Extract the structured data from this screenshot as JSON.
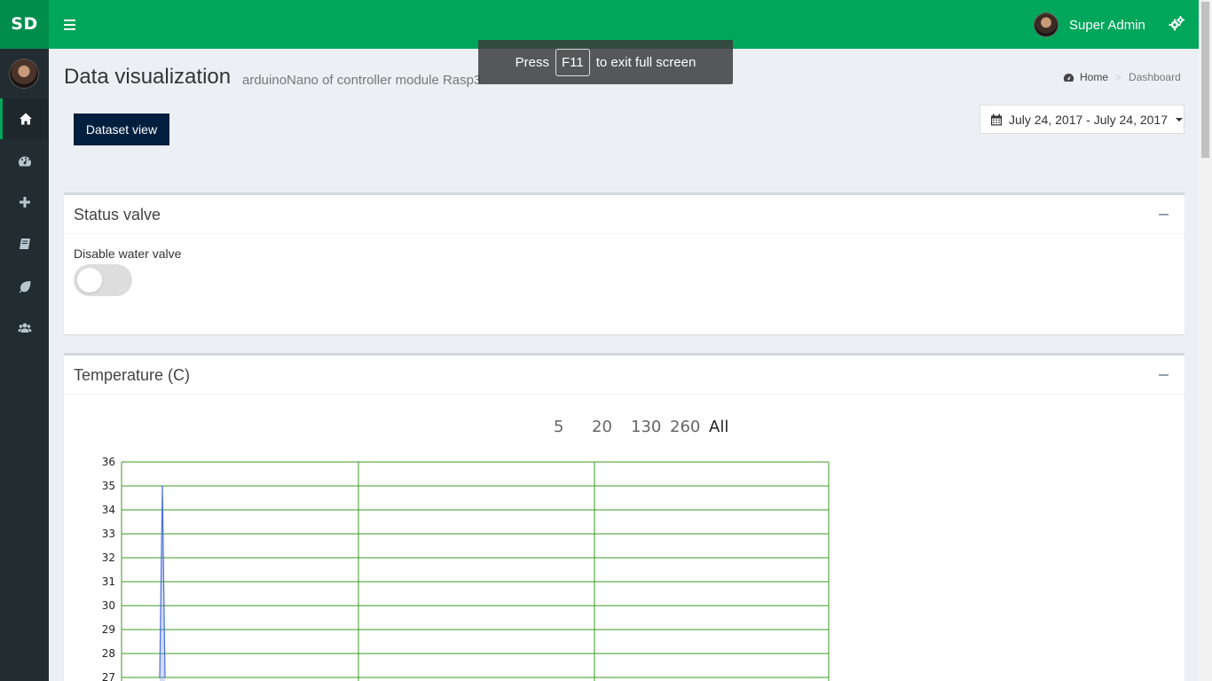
{
  "header": {
    "logo": "SD",
    "user_name": "Super Admin"
  },
  "fullscreen_notice": {
    "before": "Press",
    "key": "F11",
    "after": "to exit full screen"
  },
  "sidebar": {
    "items": [
      {
        "icon": "home-icon",
        "active": true
      },
      {
        "icon": "dashboard-icon",
        "active": false
      },
      {
        "icon": "plus-icon",
        "active": false
      },
      {
        "icon": "book-icon",
        "active": false
      },
      {
        "icon": "leaf-icon",
        "active": false
      },
      {
        "icon": "users-icon",
        "active": false
      }
    ]
  },
  "page": {
    "title": "Data visualization",
    "subtitle": "arduinoNano of controller module Rasp3"
  },
  "breadcrumb": {
    "home": "Home",
    "current": "Dashboard"
  },
  "toolbar": {
    "dataset_button": "Dataset view",
    "date_range": "July 24, 2017 - July 24, 2017"
  },
  "status_box": {
    "title": "Status valve",
    "toggle_label": "Disable water valve",
    "toggle_on": false
  },
  "temperature_box": {
    "title": "Temperature (C)",
    "range_options": [
      "5",
      "20",
      "130",
      "260",
      "All"
    ],
    "selected_range": "All"
  },
  "colors": {
    "header": "#00a65a",
    "logo_bg": "#008d4c",
    "sidebar": "#222d32",
    "primary_button": "#001f3f",
    "grid": "#3d9a20",
    "series": "#4a6fe0"
  },
  "chart_data": {
    "type": "line",
    "title": "",
    "ylim": [
      27,
      36
    ],
    "y_ticks": [
      36,
      35,
      34,
      33,
      32,
      31,
      30,
      29,
      28,
      27
    ],
    "series": [
      {
        "values": [
          27,
          35,
          27
        ]
      }
    ]
  }
}
